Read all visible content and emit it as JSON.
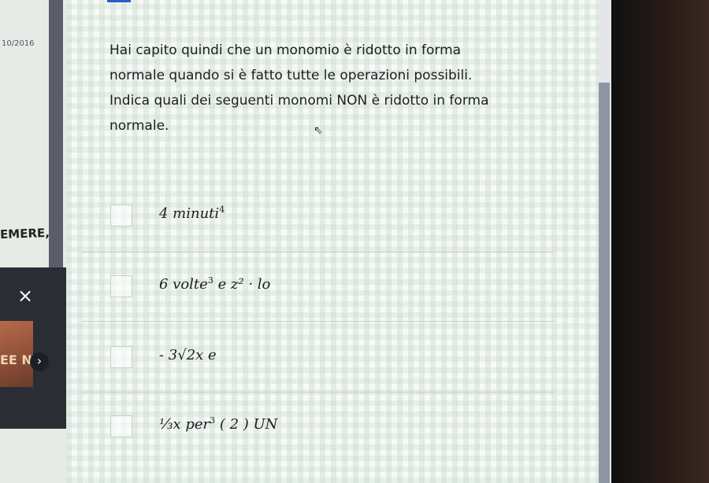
{
  "left_panel": {
    "date": "10/2016",
    "scribble": "EMERE,",
    "close_glyph": "×",
    "thumb_text": "EE\nNE",
    "next_glyph": "›"
  },
  "question": {
    "text": "Hai capito quindi che un monomio è ridotto in forma normale quando si è fatto tutte le operazioni possibili. Indica quali dei seguenti monomi NON è ridotto in forma normale."
  },
  "options": [
    {
      "label": "4 minuti",
      "exp": "4",
      "suffix": ""
    },
    {
      "label": "6 volte",
      "exp": "3",
      "suffix": "e z² · lo"
    },
    {
      "label": "- 3√2x e",
      "exp": "",
      "suffix": ""
    },
    {
      "label": "⅓x per",
      "exp": "3",
      "suffix": "( 2 ) UN"
    }
  ],
  "colors": {
    "accent": "#2a5cc7",
    "scroll_thumb": "#8e96a4"
  }
}
